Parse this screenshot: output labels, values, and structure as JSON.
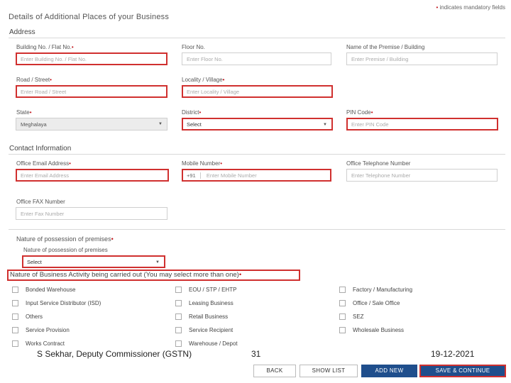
{
  "page": {
    "title": "Details of Additional Places of your Business",
    "mandatory_star": "•",
    "mandatory_text": "indicates mandatory fields"
  },
  "address": {
    "section_title": "Address",
    "building": {
      "label": "Building No. / Flat No.",
      "placeholder": "Enter Building No. / Flat No."
    },
    "floor": {
      "label": "Floor No.",
      "placeholder": "Enter Floor No."
    },
    "premise": {
      "label": "Name of the Premise / Building",
      "placeholder": "Enter Premise / Building"
    },
    "road": {
      "label": "Road / Street",
      "placeholder": "Enter Road / Street"
    },
    "locality": {
      "label": "Locality / Village",
      "placeholder": "Enter Locality / Village"
    },
    "state": {
      "label": "State",
      "value": "Meghalaya"
    },
    "district": {
      "label": "District",
      "value": "Select"
    },
    "pin": {
      "label": "PIN Code",
      "placeholder": "Enter PIN Code"
    }
  },
  "contact": {
    "section_title": "Contact Information",
    "email": {
      "label": "Office Email Address",
      "placeholder": "Enter Email Address"
    },
    "mobile": {
      "label": "Mobile Number",
      "prefix": "+91",
      "placeholder": "Enter Mobile Number"
    },
    "telephone": {
      "label": "Office Telephone Number",
      "placeholder": "Enter Telephone Number"
    },
    "fax": {
      "label": "Office FAX Number",
      "placeholder": "Enter Fax Number"
    }
  },
  "possession": {
    "title": "Nature of possession of premises",
    "sub_label": "Nature of possession of premises",
    "value": "Select"
  },
  "business_activity": {
    "title": "Nature of Business Activity being carried out (You may select more than one)",
    "col1": [
      "Bonded Warehouse",
      "Input Service Distributor (ISD)",
      "Others",
      "Service Provision",
      "Works Contract"
    ],
    "col2": [
      "EOU / STP / EHTP",
      "Leasing Business",
      "Retail Business",
      "Service Recipient",
      "Warehouse / Depot"
    ],
    "col3": [
      "Factory / Manufacturing",
      "Office / Sale Office",
      "SEZ",
      "Wholesale Business"
    ]
  },
  "footer": {
    "presenter": "S Sekhar, Deputy Commissioner (GSTN)",
    "page_number": "31",
    "date": "19-12-2021"
  },
  "buttons": {
    "back": "BACK",
    "show_list": "SHOW LIST",
    "add_new": "ADD NEW",
    "save_continue": "SAVE & CONTINUE"
  }
}
